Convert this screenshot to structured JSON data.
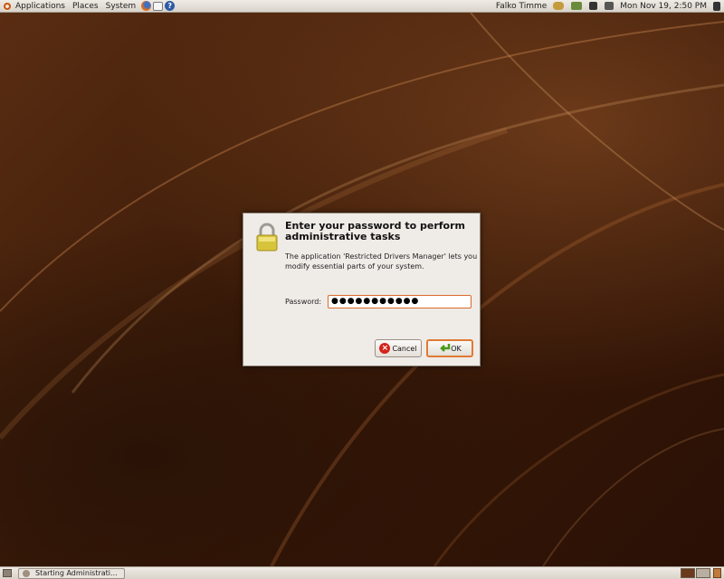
{
  "top_panel": {
    "menus": [
      "Applications",
      "Places",
      "System"
    ],
    "user": "Falko Timme",
    "datetime": "Mon Nov 19,  2:50 PM"
  },
  "dialog": {
    "title": "Enter your password to perform administrative tasks",
    "message": "The application 'Restricted Drivers Manager' lets you modify essential parts of your system.",
    "password_label": "Password:",
    "password_value": "●●●●●●●●●●●",
    "cancel_label": "Cancel",
    "ok_label": "OK"
  },
  "bottom_panel": {
    "task_label": "Starting Administrati..."
  },
  "colors": {
    "accent": "#e07a34",
    "desktop": "#3a1c0a"
  }
}
